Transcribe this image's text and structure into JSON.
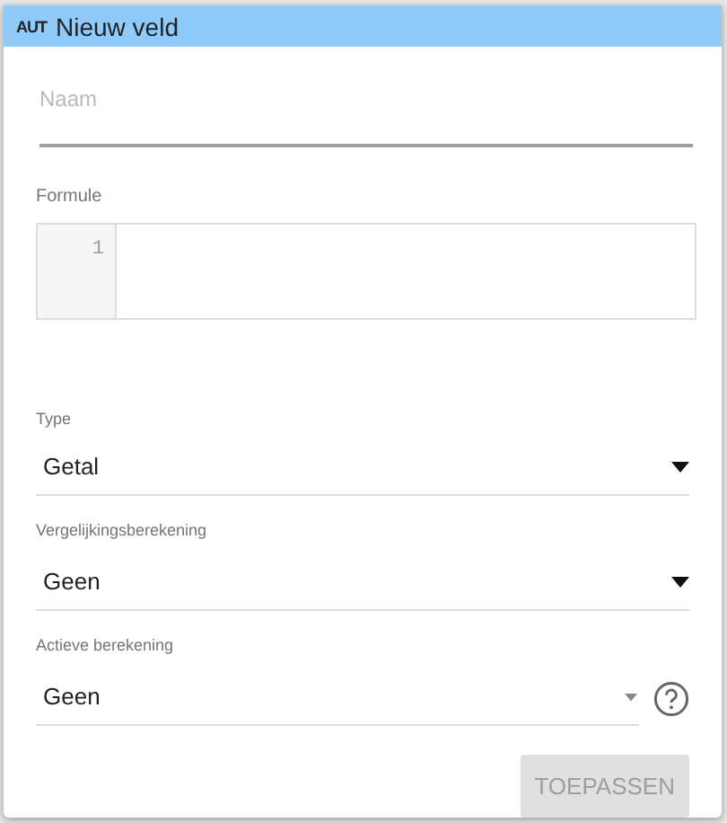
{
  "dialog": {
    "badge": "AUT",
    "title": "Nieuw veld"
  },
  "name_field": {
    "placeholder": "Naam"
  },
  "formula": {
    "label": "Formule",
    "line_numbers": [
      "1"
    ]
  },
  "selects": [
    {
      "label": "Type",
      "value": "Getal",
      "disabled": false,
      "help": false
    },
    {
      "label": "Vergelijkingsberekening",
      "value": "Geen",
      "disabled": false,
      "help": false
    },
    {
      "label": "Actieve berekening",
      "value": "Geen",
      "disabled": true,
      "help": true
    }
  ],
  "apply_button": {
    "label": "TOEPASSEN",
    "disabled": true
  }
}
